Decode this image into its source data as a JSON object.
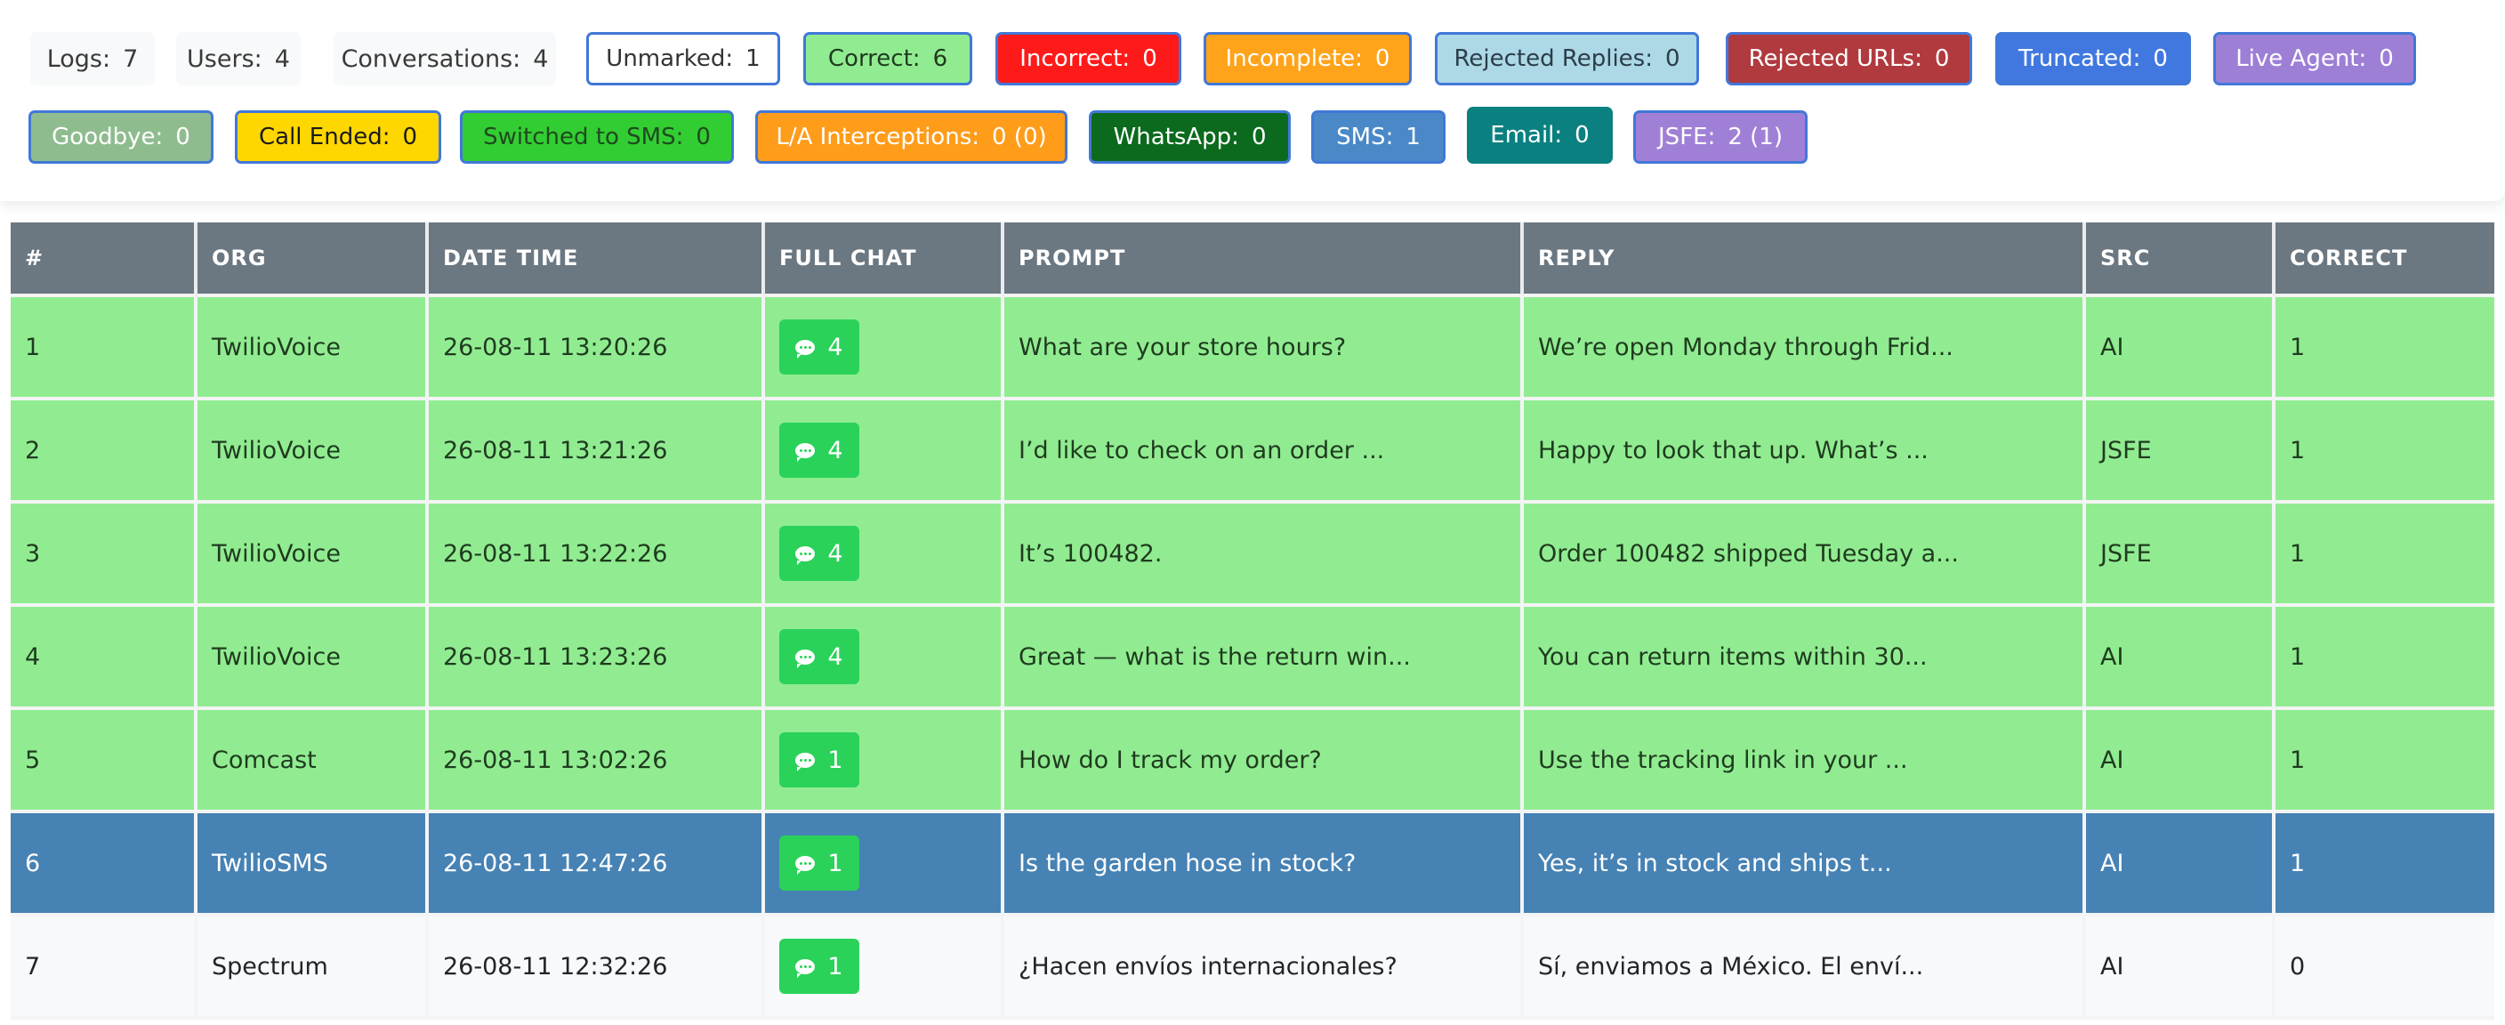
{
  "summary": {
    "logs": {
      "label": "Logs:",
      "value": "7"
    },
    "users": {
      "label": "Users:",
      "value": "4"
    },
    "conversations": {
      "label": "Conversations:",
      "value": "4"
    }
  },
  "filters": [
    {
      "label": "Unmarked:",
      "value": "1",
      "bg": "#ffffff",
      "fg": "#333333"
    },
    {
      "label": "Correct:",
      "value": "6",
      "bg": "#91ec91",
      "fg": "#1f3b1f"
    },
    {
      "label": "Incorrect:",
      "value": "0",
      "bg": "#ff1a1a",
      "fg": "#ffffff"
    },
    {
      "label": "Incomplete:",
      "value": "0",
      "bg": "#ffa31a",
      "fg": "#ffffff"
    },
    {
      "label": "Rejected Replies:",
      "value": "0",
      "bg": "#add8e6",
      "fg": "#2b3d4a"
    },
    {
      "label": "Rejected URLs:",
      "value": "0",
      "bg": "#b03a3e",
      "fg": "#ffffff"
    },
    {
      "label": "Truncated:",
      "value": "0",
      "bg": "#4178e0",
      "fg": "#ffffff"
    },
    {
      "label": "Live Agent:",
      "value": "0",
      "bg": "#9d7fd6",
      "fg": "#ffffff"
    },
    {
      "label": "Goodbye:",
      "value": "0",
      "bg": "#8fbc8f",
      "fg": "#ffffff"
    },
    {
      "label": "Call Ended:",
      "value": "0",
      "bg": "#ffd700",
      "fg": "#1a1a1a"
    },
    {
      "label": "Switched to SMS:",
      "value": "0",
      "bg": "#32cd32",
      "fg": "#1f4a1f"
    },
    {
      "label": "L/A Interceptions:",
      "value": "0 (0)",
      "bg": "#ff9c1a",
      "fg": "#ffffff"
    },
    {
      "label": "WhatsApp:",
      "value": "0",
      "bg": "#0b6a1d",
      "fg": "#ffffff"
    },
    {
      "label": "SMS:",
      "value": "1",
      "bg": "#4a88c8",
      "fg": "#ffffff"
    },
    {
      "label": "Email:",
      "value": "0",
      "bg": "#0b8080",
      "fg": "#ffffff"
    },
    {
      "label": "JSFE:",
      "value": "2 (1)",
      "bg": "#a080d6",
      "fg": "#ffffff"
    }
  ],
  "table": {
    "headers": [
      "#",
      "ORG",
      "DATE TIME",
      "FULL CHAT",
      "PROMPT",
      "REPLY",
      "SRC",
      "CORRECT"
    ],
    "rows": [
      {
        "num": "1",
        "org": "TwilioVoice",
        "datetime": "26-08-11 13:20:26",
        "chat": "4",
        "prompt": "What are your store hours?",
        "reply": "We’re open Monday through Frid...",
        "src": "AI",
        "correct": "1"
      },
      {
        "num": "2",
        "org": "TwilioVoice",
        "datetime": "26-08-11 13:21:26",
        "chat": "4",
        "prompt": "I’d like to check on an order ...",
        "reply": "Happy to look that up. What’s ...",
        "src": "JSFE",
        "correct": "1"
      },
      {
        "num": "3",
        "org": "TwilioVoice",
        "datetime": "26-08-11 13:22:26",
        "chat": "4",
        "prompt": "It’s 100482.",
        "reply": "Order 100482 shipped Tuesday a...",
        "src": "JSFE",
        "correct": "1"
      },
      {
        "num": "4",
        "org": "TwilioVoice",
        "datetime": "26-08-11 13:23:26",
        "chat": "4",
        "prompt": "Great — what is the return win...",
        "reply": "You can return items within 30...",
        "src": "AI",
        "correct": "1"
      },
      {
        "num": "5",
        "org": "Comcast",
        "datetime": "26-08-11 13:02:26",
        "chat": "1",
        "prompt": "How do I track my order?",
        "reply": "Use the tracking link in your ...",
        "src": "AI",
        "correct": "1"
      },
      {
        "num": "6",
        "org": "TwilioSMS",
        "datetime": "26-08-11 12:47:26",
        "chat": "1",
        "prompt": "Is the garden hose in stock?",
        "reply": "Yes, it’s in stock and ships t...",
        "src": "AI",
        "correct": "1"
      },
      {
        "num": "7",
        "org": "Spectrum",
        "datetime": "26-08-11 12:32:26",
        "chat": "1",
        "prompt": "¿Hacen envíos internacionales?",
        "reply": "Sí, enviamos a México. El enví...",
        "src": "AI",
        "correct": "0"
      }
    ]
  }
}
